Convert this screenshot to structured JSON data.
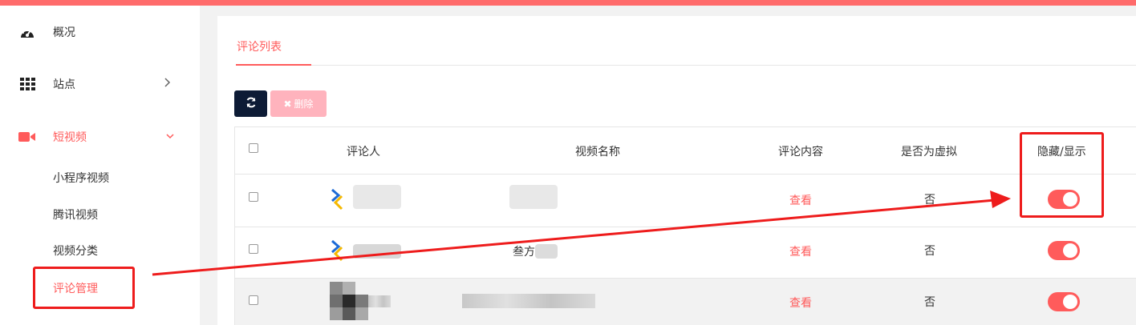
{
  "sidebar": {
    "items": [
      {
        "label": "概况",
        "icon": "dashboard-icon"
      },
      {
        "label": "站点",
        "icon": "grid-icon"
      },
      {
        "label": "短视频",
        "icon": "video-camera-icon"
      }
    ],
    "subitems": [
      {
        "label": "小程序视频"
      },
      {
        "label": "腾讯视频"
      },
      {
        "label": "视频分类"
      },
      {
        "label": "评论管理"
      }
    ]
  },
  "main": {
    "tab": "评论列表",
    "delete_label": "删除",
    "table": {
      "headers": [
        "评论人",
        "视频名称",
        "评论内容",
        "是否为虚拟",
        "隐藏/显示"
      ],
      "rows": [
        {
          "commenter_suffix": "",
          "video_prefix": "",
          "content": "查看",
          "virtual": "否",
          "visible": true
        },
        {
          "commenter_suffix": "",
          "video_prefix": "叁方",
          "content": "查看",
          "virtual": "否",
          "visible": true
        },
        {
          "commenter_suffix": "",
          "video_prefix": "",
          "content": "查看",
          "virtual": "否",
          "visible": true
        }
      ]
    }
  },
  "colors": {
    "accent": "#ff5b5b",
    "dark_button": "#0d1b35",
    "annotation": "#ee1c1c"
  }
}
